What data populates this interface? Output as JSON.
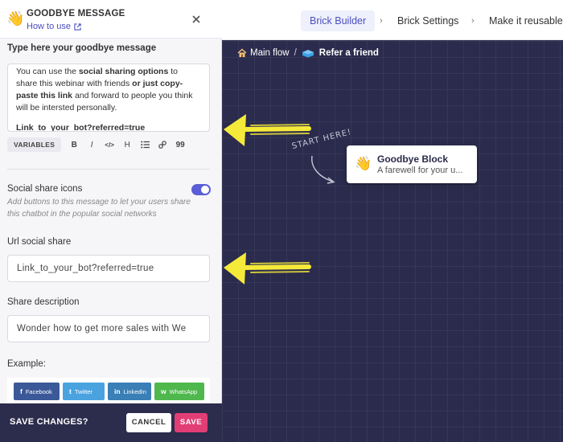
{
  "panel": {
    "emoji": "👋",
    "title": "GOODBYE MESSAGE",
    "how_to_use": "How to use",
    "message_label": "Type here your goodbye message",
    "message": {
      "t1": "You can use the ",
      "b1": "social sharing options",
      "t2": " to share this webinar with friends ",
      "b2": "or just copy-paste this link",
      "t3": " and forward to people you think will be intersted personally.",
      "link": "Link_to_your_bot?referred=true"
    },
    "toolbar": {
      "variables": "VARIABLES",
      "bold": "B",
      "italic": "I",
      "code": "</>",
      "heading": "H",
      "quote": "99"
    },
    "social_label": "Social share icons",
    "social_enabled": true,
    "social_hint": "Add buttons to this message to let your users share this chatbot in the popular social networks",
    "url_label": "Url social share",
    "url_value": "Link_to_your_bot?referred=true",
    "desc_label": "Share description",
    "desc_value": "Wonder how to get more sales with We",
    "example_label": "Example:",
    "share_buttons": [
      {
        "label": "Facebook",
        "icon": "f"
      },
      {
        "label": "Twitter",
        "icon": "t"
      },
      {
        "label": "LinkedIn",
        "icon": "in"
      },
      {
        "label": "WhatsApp",
        "icon": "w"
      }
    ],
    "footer": {
      "title": "SAVE CHANGES?",
      "cancel": "CANCEL",
      "save": "SAVE"
    }
  },
  "topbar": {
    "steps": [
      "Brick Builder",
      "Brick Settings",
      "Make it reusable"
    ],
    "active_step": "Brick Builder"
  },
  "flow": {
    "main": "Main flow",
    "current": "Refer a friend"
  },
  "canvas": {
    "start_here": "START HERE!",
    "node": {
      "emoji": "👋",
      "title": "Goodbye Block",
      "subtitle": "A farewell for your u..."
    }
  },
  "colors": {
    "accent": "#5a5ed6",
    "save": "#e23e76",
    "canvas_bg": "#2b2b4d",
    "annotation_arrow": "#f5ea3a"
  }
}
